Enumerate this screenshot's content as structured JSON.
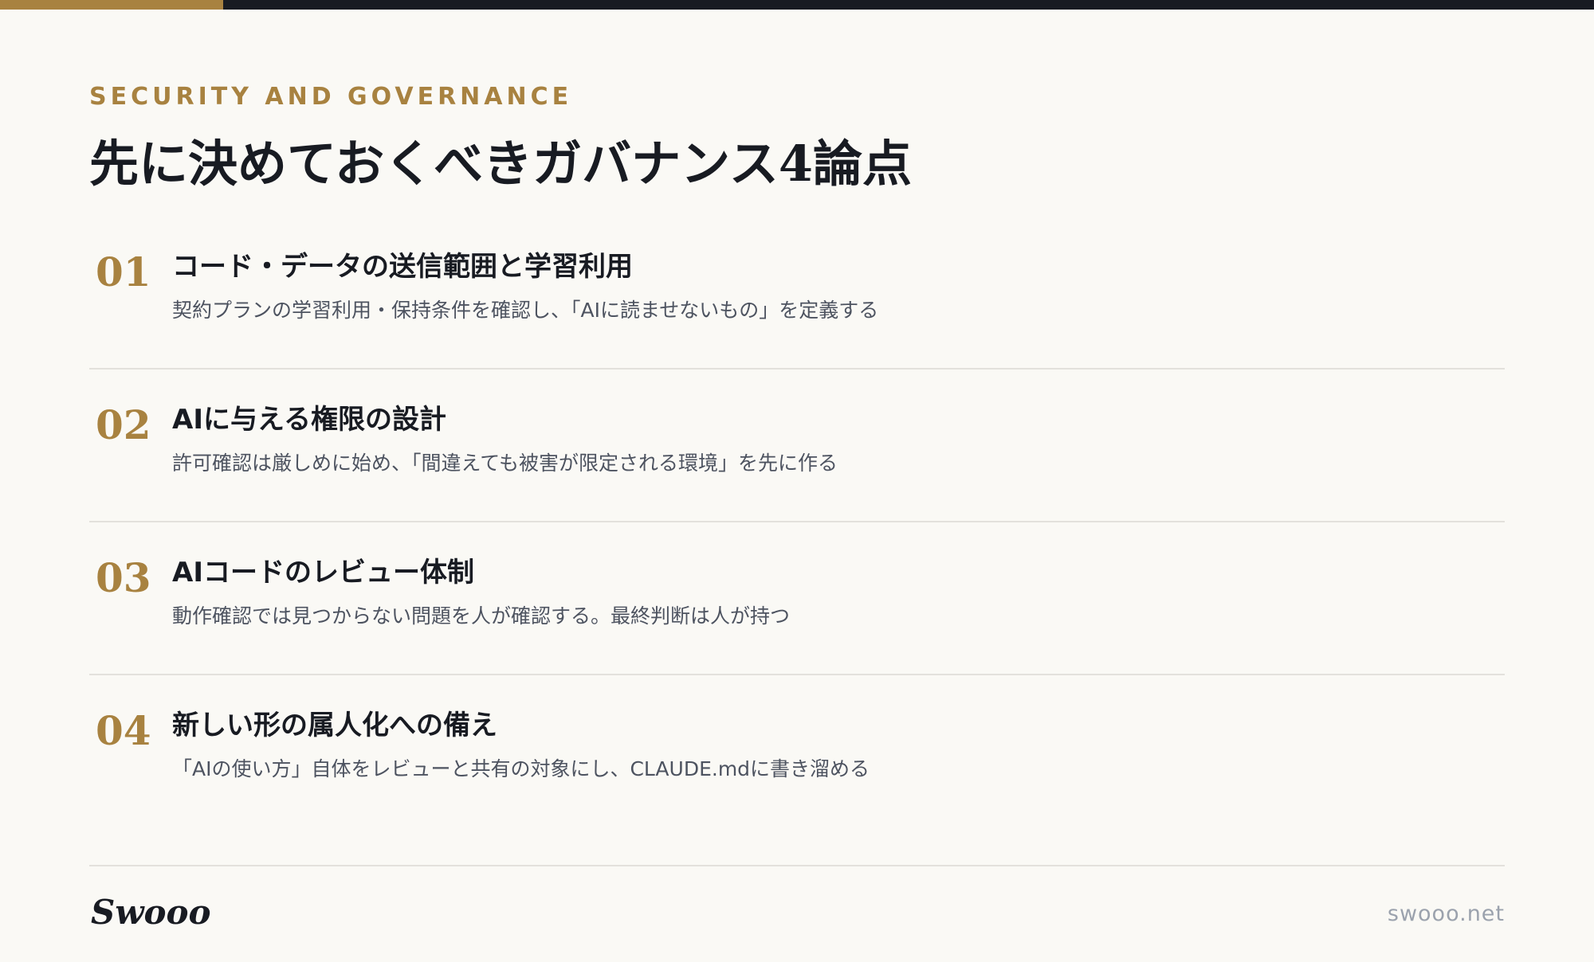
{
  "colors": {
    "accent": "#a88240",
    "dark": "#181b22",
    "background": "#faf9f5",
    "divider": "#e3e1dc",
    "muted": "#4d5360"
  },
  "header": {
    "eyebrow": "SECURITY AND GOVERNANCE",
    "title": "先に決めておくべきガバナンス4論点"
  },
  "items": [
    {
      "number": "01",
      "title": "コード・データの送信範囲と学習利用",
      "description": "契約プランの学習利用・保持条件を確認し、「AIに読ませないもの」を定義する"
    },
    {
      "number": "02",
      "title": "AIに与える権限の設計",
      "description": "許可確認は厳しめに始め、「間違えても被害が限定される環境」を先に作る"
    },
    {
      "number": "03",
      "title": "AIコードのレビュー体制",
      "description": "動作確認では見つからない問題を人が確認する。最終判断は人が持つ"
    },
    {
      "number": "04",
      "title": "新しい形の属人化への備え",
      "description": "「AIの使い方」自体をレビューと共有の対象にし、CLAUDE.mdに書き溜める"
    }
  ],
  "footer": {
    "logo": "Swooo",
    "site": "swooo.net"
  }
}
